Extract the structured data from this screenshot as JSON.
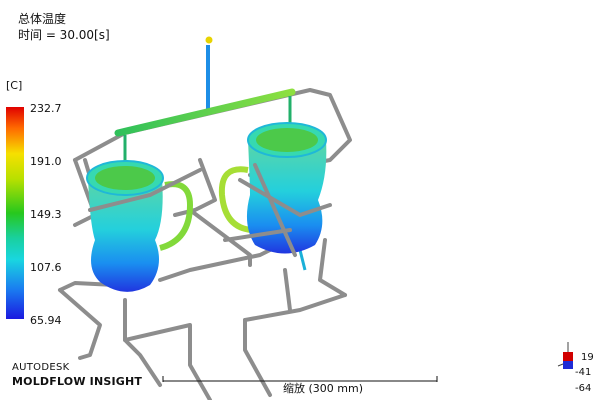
{
  "header": {
    "title": "总体温度",
    "time": "时间 = 30.00[s]"
  },
  "legend": {
    "unit": "[C]",
    "ticks": [
      "232.7",
      "191.0",
      "149.3",
      "107.6",
      "65.94"
    ],
    "colors": {
      "max": "#e00000",
      "mid": "#27c81d",
      "min": "#1b19e0"
    }
  },
  "brand": {
    "line1": "AUTODESK",
    "line2": "MOLDFLOW INSIGHT"
  },
  "scale": {
    "label": "缩放 (300 mm)"
  },
  "axis": {
    "values": [
      "19",
      "-41",
      "-64"
    ]
  }
}
